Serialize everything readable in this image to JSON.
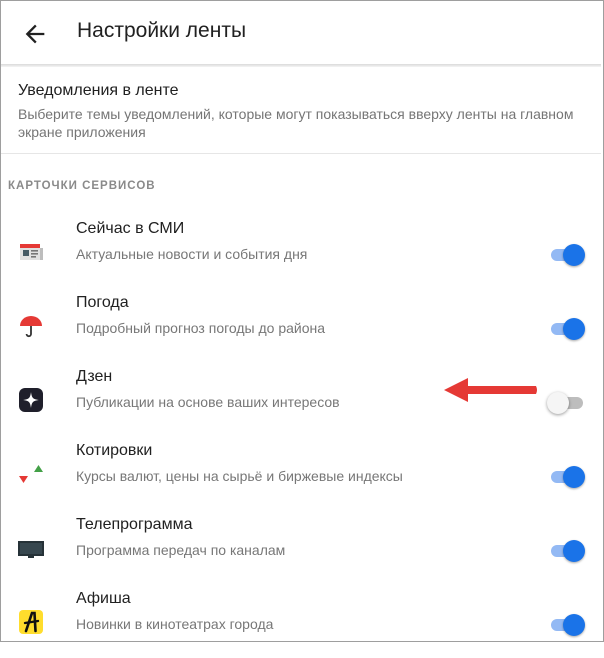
{
  "header": {
    "title": "Настройки ленты"
  },
  "notifications": {
    "title": "Уведомления в ленте",
    "description": "Выберите темы уведомлений, которые могут показываться вверху ленты на главном экране приложения"
  },
  "section_title": "КАРТОЧКИ СЕРВИСОВ",
  "services": [
    {
      "name": "Сейчас в СМИ",
      "desc": "Актуальные новости и события дня",
      "icon": "newspaper-icon",
      "enabled": true
    },
    {
      "name": "Погода",
      "desc": "Подробный прогноз погоды до района",
      "icon": "umbrella-icon",
      "enabled": true
    },
    {
      "name": "Дзен",
      "desc": "Публикации на основе ваших интересов",
      "icon": "zen-icon",
      "enabled": false
    },
    {
      "name": "Котировки",
      "desc": "Курсы валют, цены на сырьё и биржевые индексы",
      "icon": "quotes-icon",
      "enabled": true
    },
    {
      "name": "Телепрограмма",
      "desc": "Программа передач по каналам",
      "icon": "tv-icon",
      "enabled": true
    },
    {
      "name": "Афиша",
      "desc": "Новинки в кинотеатрах города",
      "icon": "afisha-icon",
      "enabled": true
    }
  ],
  "colors": {
    "accent": "#1a73e8",
    "arrow": "#e53935"
  }
}
